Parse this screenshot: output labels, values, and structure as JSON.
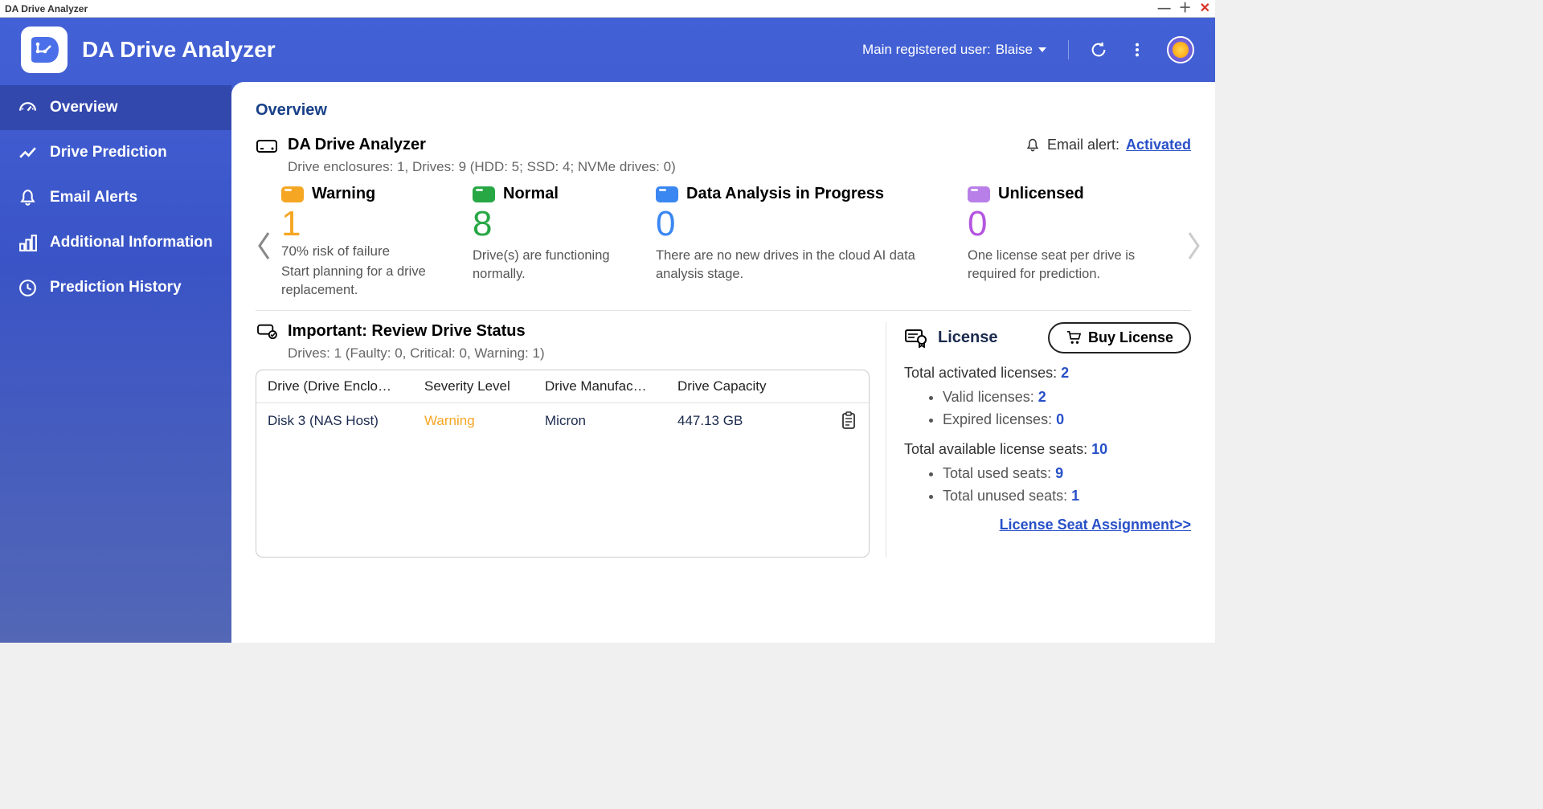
{
  "window": {
    "title": "DA Drive Analyzer"
  },
  "header": {
    "app_title": "DA Drive Analyzer",
    "user_label": "Main registered user:",
    "user_name": "Blaise"
  },
  "sidebar": {
    "items": [
      {
        "label": "Overview"
      },
      {
        "label": "Drive Prediction"
      },
      {
        "label": "Email Alerts"
      },
      {
        "label": "Additional Information"
      },
      {
        "label": "Prediction History"
      }
    ]
  },
  "main": {
    "page_title": "Overview",
    "analyzer_title": "DA Drive Analyzer",
    "drive_summary": "Drive enclosures: 1, Drives: 9 (HDD: 5; SSD: 4; NVMe drives: 0)",
    "email_alert_label": "Email alert:",
    "email_alert_status": "Activated",
    "status": {
      "warning": {
        "title": "Warning",
        "count": "1",
        "sub1": "70% risk of failure",
        "sub2": "Start planning for a drive replacement."
      },
      "normal": {
        "title": "Normal",
        "count": "8",
        "sub2": "Drive(s) are functioning normally."
      },
      "progress": {
        "title": "Data Analysis in Progress",
        "count": "0",
        "sub2": "There are no new drives in the cloud AI data analysis stage."
      },
      "unlicensed": {
        "title": "Unlicensed",
        "count": "0",
        "sub2": "One license seat per drive is required for prediction."
      }
    },
    "review": {
      "title": "Important: Review Drive Status",
      "summary": "Drives: 1 (Faulty: 0, Critical: 0, Warning: 1)",
      "columns": {
        "c1": "Drive (Drive Enclo…",
        "c2": "Severity Level",
        "c3": "Drive Manufac…",
        "c4": "Drive Capacity"
      },
      "rows": [
        {
          "drive": "Disk 3 (NAS Host)",
          "severity": "Warning",
          "manufacturer": "Micron",
          "capacity": "447.13 GB"
        }
      ]
    },
    "license": {
      "title": "License",
      "buy_label": "Buy License",
      "total_activated_label": "Total activated licenses:",
      "total_activated": "2",
      "valid_label": "Valid licenses:",
      "valid": "2",
      "expired_label": "Expired licenses:",
      "expired": "0",
      "total_seats_label": "Total available license seats:",
      "total_seats": "10",
      "used_label": "Total used seats:",
      "used": "9",
      "unused_label": "Total unused seats:",
      "unused": "1",
      "link": "License Seat Assignment>>"
    }
  }
}
